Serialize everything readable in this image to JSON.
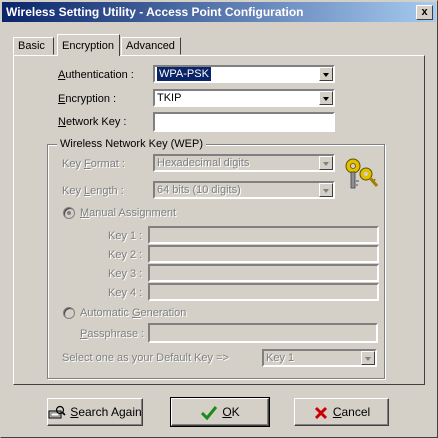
{
  "window": {
    "title": "Wireless Setting Utility - Access Point Configuration",
    "close_glyph": "x"
  },
  "tabs": [
    {
      "label": "Basic"
    },
    {
      "label": "Encryption"
    },
    {
      "label": "Advanced"
    }
  ],
  "form": {
    "authentication": {
      "label_u": "A",
      "label_rest": "uthentication :",
      "value": "WPA-PSK"
    },
    "encryption": {
      "label_u": "E",
      "label_rest": "ncryption :",
      "value": "TKIP"
    },
    "network_key": {
      "label_u": "N",
      "label_rest": "etwork Key :",
      "value": ""
    }
  },
  "wep": {
    "group_title": "Wireless Network Key (WEP)",
    "key_format": {
      "label_pre": "Key ",
      "label_u": "F",
      "label_rest": "ormat :",
      "value": "Hexadecimal digits"
    },
    "key_length": {
      "label_pre": "Key ",
      "label_u": "L",
      "label_rest": "ength :",
      "value": "64 bits (10 digits)"
    },
    "manual": {
      "label_u": "M",
      "label_rest": "anual Assignment"
    },
    "keys": [
      {
        "label": "Key 1 :"
      },
      {
        "label": "Key 2 :"
      },
      {
        "label": "Key 3 :"
      },
      {
        "label": "Key 4 :"
      }
    ],
    "automatic": {
      "label_pre": "Automatic ",
      "label_u": "G",
      "label_rest": "eneration"
    },
    "passphrase": {
      "label_u": "P",
      "label_rest": "assphrase :"
    },
    "default_key": {
      "label": "Select one as your Default Key =>",
      "value": "Key 1"
    }
  },
  "buttons": {
    "search": {
      "label_u": "S",
      "label_rest": "earch Again"
    },
    "ok": {
      "label_u": "O",
      "label_rest": "K"
    },
    "cancel": {
      "label_u": "C",
      "label_rest": "ancel"
    }
  },
  "colors": {
    "title_start": "#0a246a",
    "title_end": "#a6caf0",
    "face": "#d4d0c8",
    "ok_check": "#1a8a1a",
    "cancel_x": "#cc0000",
    "keys_icon": "#e0c000"
  }
}
